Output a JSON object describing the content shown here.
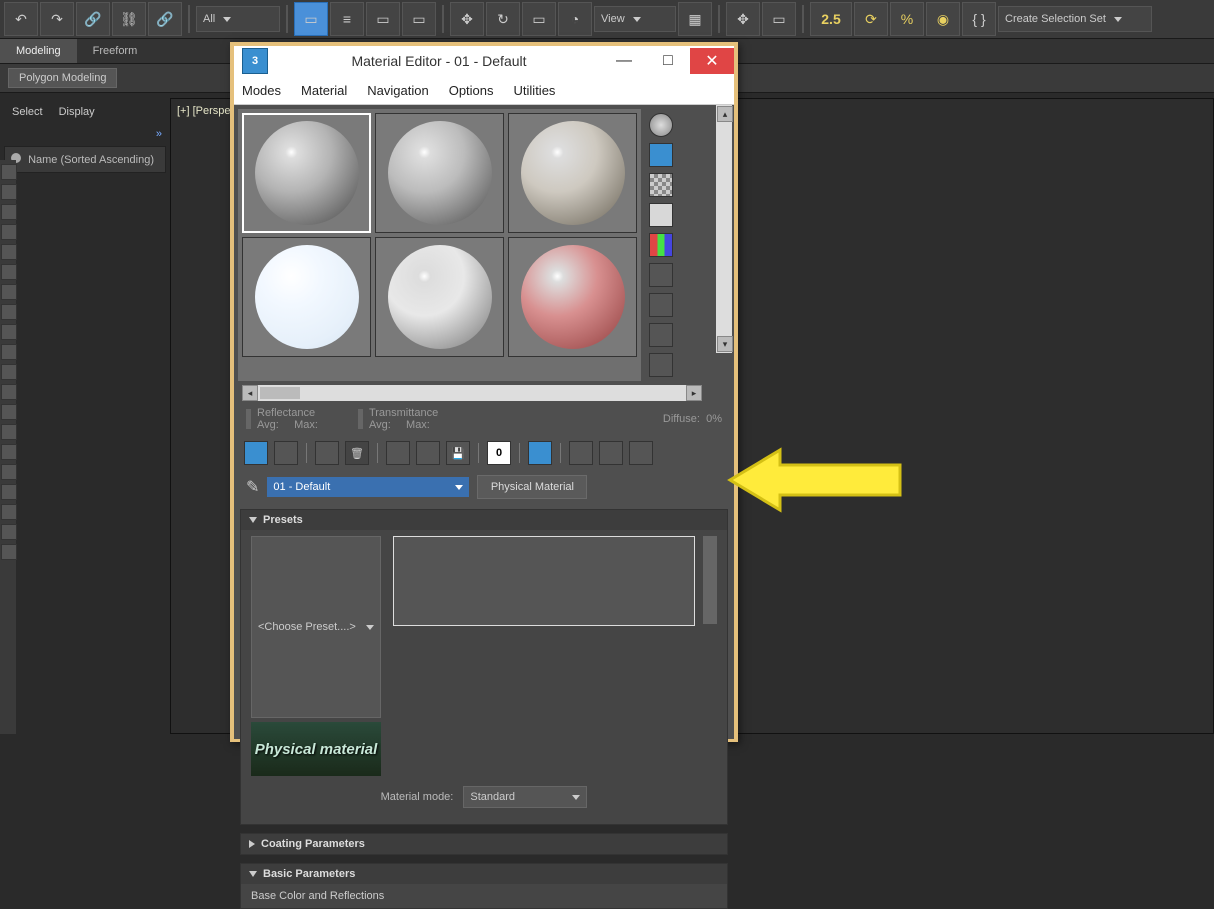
{
  "toolbar": {
    "selection_filter": "All",
    "ref_mode": "View",
    "snap_text": "2.5",
    "selection_set_label": "Create Selection Set"
  },
  "ribbon": {
    "tabs": [
      "Modeling",
      "Freeform"
    ],
    "active": 0,
    "sub": "Polygon Modeling"
  },
  "left_panel": {
    "cmds": [
      "Select",
      "Display"
    ],
    "list_header": "Name (Sorted Ascending)"
  },
  "viewport": {
    "tag": "[+] [Perspective]"
  },
  "material_editor": {
    "title": "Material Editor - 01 - Default",
    "menus": [
      "Modes",
      "Material",
      "Navigation",
      "Options",
      "Utilities"
    ],
    "stats": {
      "reflectance": "Reflectance",
      "transmittance": "Transmittance",
      "avg": "Avg:",
      "max": "Max:",
      "diffuse": "Diffuse:",
      "diffuse_val": "0%"
    },
    "material_name": "01 - Default",
    "material_type": "Physical Material",
    "presets": {
      "header": "Presets",
      "choose": "<Choose Preset....>",
      "thumb_text": "Physical material",
      "mode_label": "Material mode:",
      "mode_value": "Standard"
    },
    "rollouts": {
      "coating": "Coating Parameters",
      "basic": "Basic Parameters",
      "base_color": "Base Color and Reflections"
    }
  }
}
